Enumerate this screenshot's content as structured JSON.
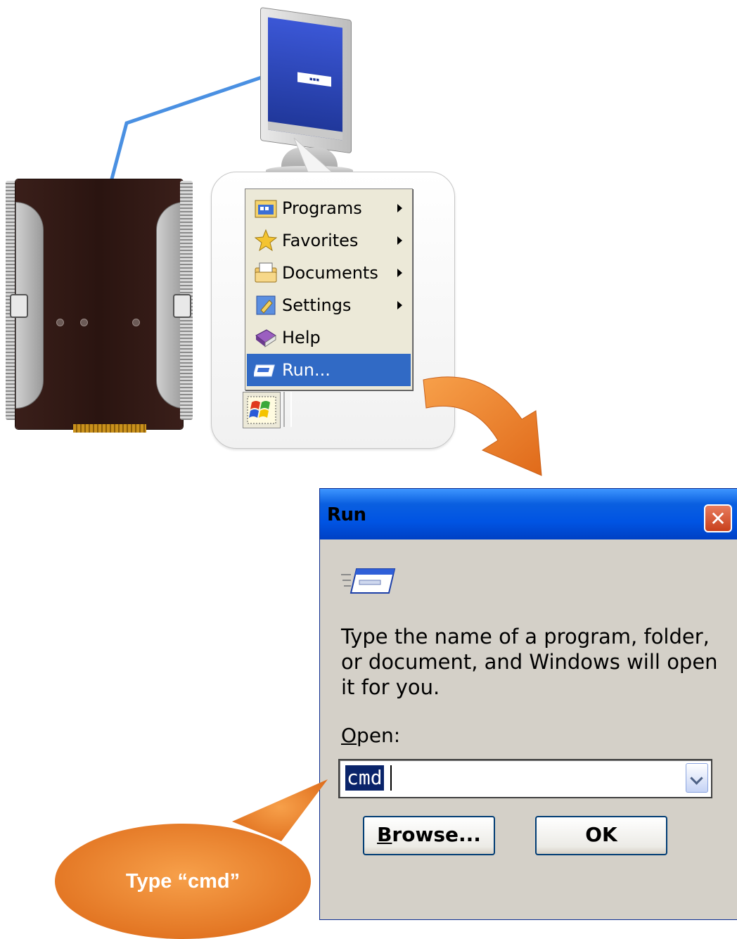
{
  "start_menu": {
    "items": [
      {
        "label": "Programs",
        "icon": "programs-icon",
        "submenu": true
      },
      {
        "label": "Favorites",
        "icon": "favorites-star-icon",
        "submenu": true
      },
      {
        "label": "Documents",
        "icon": "documents-icon",
        "submenu": true
      },
      {
        "label": "Settings",
        "icon": "settings-icon",
        "submenu": true
      },
      {
        "label": "Help",
        "icon": "help-book-icon",
        "submenu": false
      },
      {
        "label": "Run...",
        "icon": "run-icon",
        "submenu": false,
        "highlighted": true
      }
    ],
    "start_button_icon": "windows-flag-icon"
  },
  "run_dialog": {
    "title": "Run",
    "close_glyph": "✕",
    "message": "Type the name of a program, folder, or document, and Windows will open it for you.",
    "open_label_first": "O",
    "open_label_rest": "pen:",
    "input_value": "cmd",
    "browse_label_first": "B",
    "browse_label_rest": "rowse...",
    "ok_label": "OK"
  },
  "callout": {
    "text": "Type “cmd”"
  },
  "colors": {
    "orange": "#e8782a",
    "highlight": "#316ac5",
    "titlebar": "#0054e3",
    "cable": "#4a90e2"
  }
}
